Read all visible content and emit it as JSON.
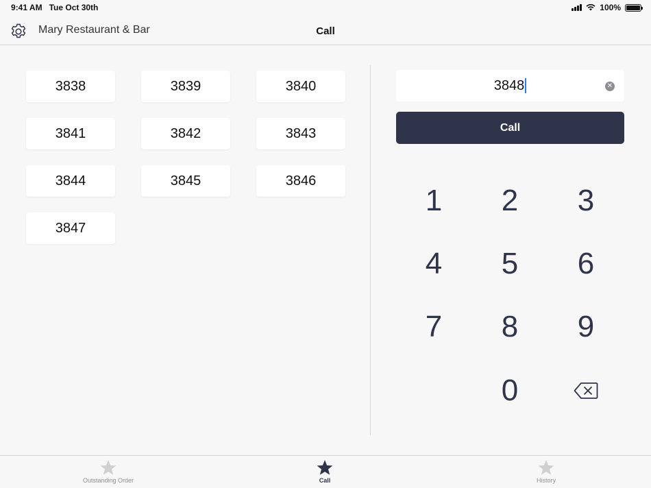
{
  "status_bar": {
    "time": "9:41 AM",
    "date": "Tue Oct 30th",
    "battery": "100%",
    "icons": [
      "signal-icon",
      "wifi-icon",
      "battery-icon"
    ]
  },
  "header": {
    "restaurant_name": "Mary Restaurant & Bar",
    "title": "Call",
    "settings_icon": "gear-icon"
  },
  "orders": [
    "3838",
    "3839",
    "3840",
    "3841",
    "3842",
    "3843",
    "3844",
    "3845",
    "3846",
    "3847"
  ],
  "number_input": {
    "value": "3848",
    "clear_icon": "clear-icon"
  },
  "call_button_label": "Call",
  "keypad": [
    "1",
    "2",
    "3",
    "4",
    "5",
    "6",
    "7",
    "8",
    "9",
    "0"
  ],
  "backspace_icon": "backspace-icon",
  "tabs": [
    {
      "label": "Outstanding Order",
      "icon": "star-icon",
      "active": false
    },
    {
      "label": "Call",
      "icon": "star-icon",
      "active": true
    },
    {
      "label": "History",
      "icon": "star-icon",
      "active": false
    }
  ],
  "colors": {
    "accent": "#30344b",
    "inactive_tab": "#d0d0d0",
    "caret": "#2f7bf6",
    "background": "#f7f7f7"
  }
}
